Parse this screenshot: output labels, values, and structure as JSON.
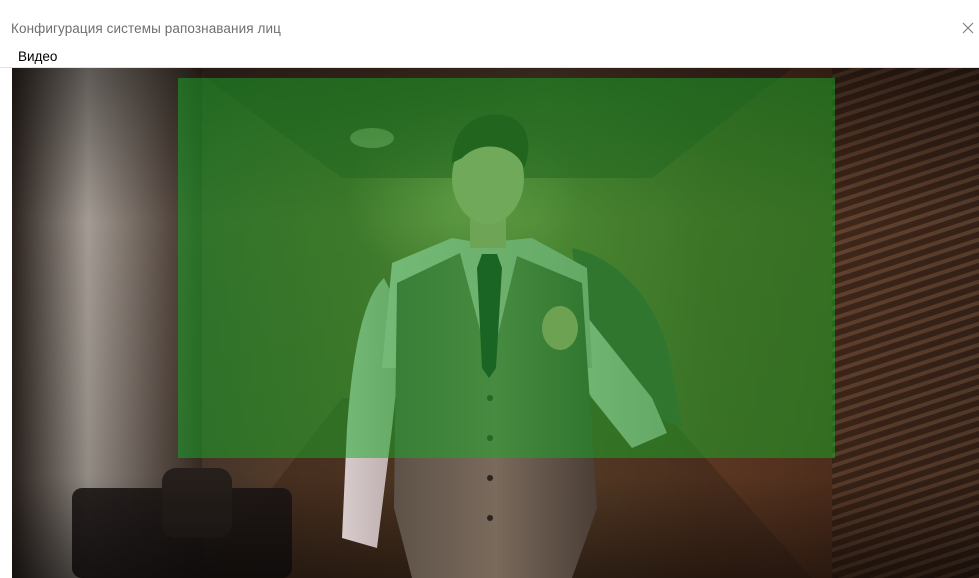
{
  "window": {
    "title": "Конфигурация системы рапознавания лиц",
    "close_glyph": "×"
  },
  "menu": {
    "items": [
      {
        "label": "Видео"
      }
    ]
  },
  "video": {
    "overlay_color": "#18a828"
  },
  "icons": {
    "close": "close-icon"
  }
}
